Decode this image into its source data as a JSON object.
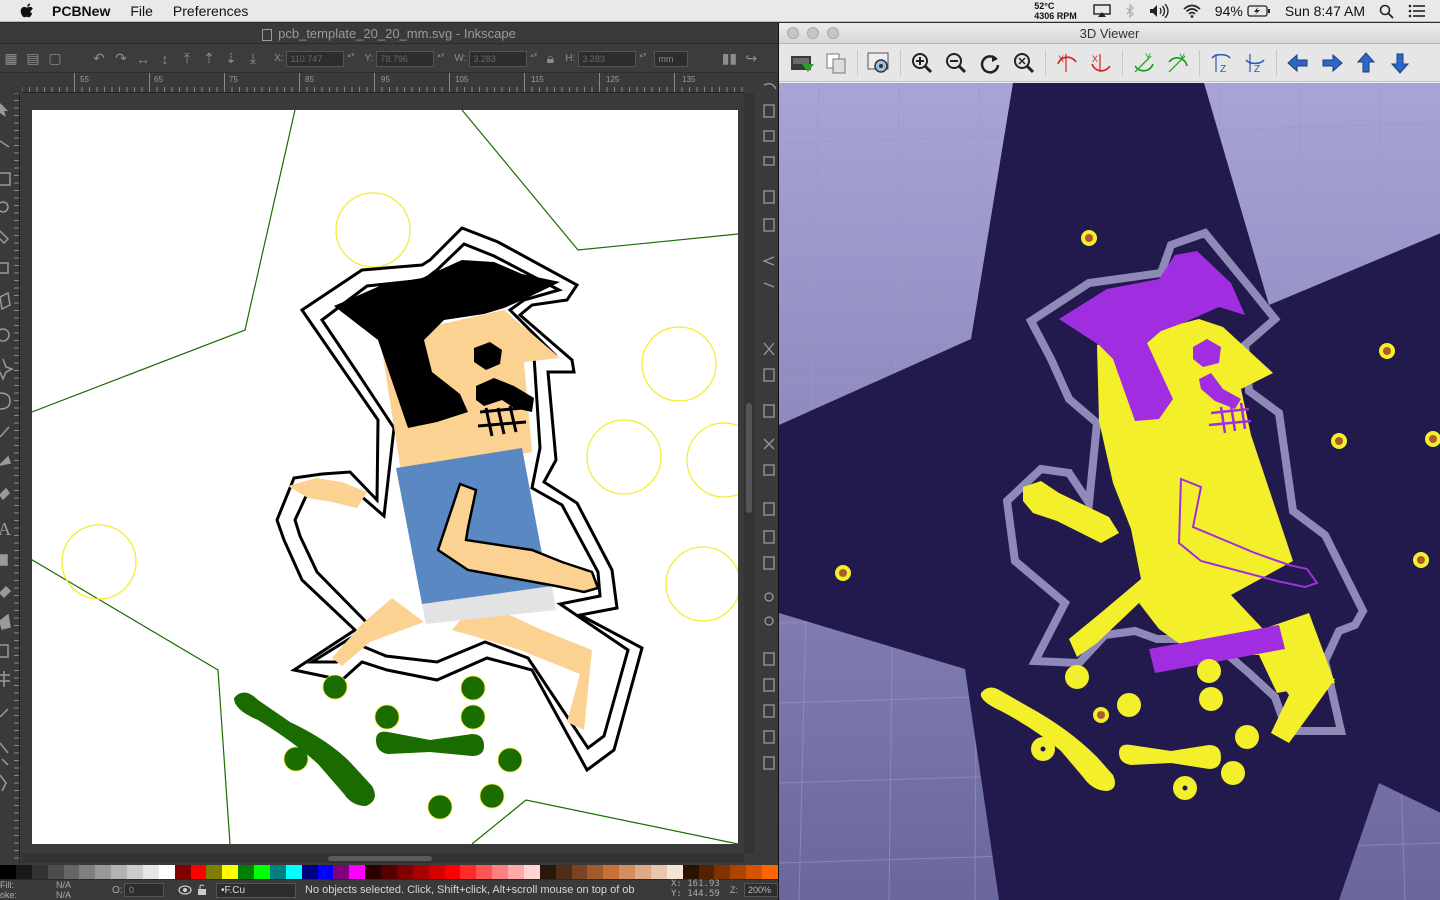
{
  "menubar": {
    "app_name": "PCBNew",
    "menus": [
      "File",
      "Preferences"
    ],
    "temp": "52°C",
    "rpm": "4306 RPM",
    "battery": "94%",
    "clock": "Sun 8:47 AM"
  },
  "inkscape": {
    "title": "pcb_template_20_20_mm.svg - Inkscape",
    "toolbar": {
      "x_label": "X:",
      "x_value": "110.747",
      "y_label": "Y:",
      "y_value": "78.796",
      "w_label": "W:",
      "w_value": "3.283",
      "h_label": "H:",
      "h_value": "3.283",
      "unit": "mm"
    },
    "ruler_ticks": [
      "55",
      "65",
      "75",
      "85",
      "95",
      "105",
      "115",
      "125",
      "135"
    ],
    "status": {
      "fill_label": "Fill:",
      "stroke_label": "oke:",
      "fill_value": "N/A",
      "stroke_value": "N/A",
      "opacity_label": "O:",
      "opacity_value": "0",
      "layer": "•F.Cu",
      "message": "No objects selected. Click, Shift+click, Alt+scroll mouse on top of ob",
      "coord_x_label": "X:",
      "coord_x": "161.93",
      "coord_y_label": "Y:",
      "coord_y": "144.59",
      "zoom_label": "Z:",
      "zoom": "200%"
    },
    "palette_colors": [
      "#000000",
      "#1a1a1a",
      "#333333",
      "#4d4d4d",
      "#666666",
      "#808080",
      "#999999",
      "#b3b3b3",
      "#cccccc",
      "#e6e6e6",
      "#ffffff",
      "#800000",
      "#ff0000",
      "#808000",
      "#ffff00",
      "#008000",
      "#00ff00",
      "#008080",
      "#00ffff",
      "#000080",
      "#0000ff",
      "#800080",
      "#ff00ff",
      "#2b0000",
      "#550000",
      "#800000",
      "#aa0000",
      "#d40000",
      "#ff0000",
      "#ff2a2a",
      "#ff5555",
      "#ff8080",
      "#ffaaaa",
      "#ffd5d5",
      "#28170b",
      "#502d16",
      "#784421",
      "#a05a2c",
      "#c87137",
      "#d38d5f",
      "#deaa87",
      "#e9c6af",
      "#f4e3d7",
      "#2b1100",
      "#552200",
      "#803300",
      "#aa4400",
      "#d45500",
      "#ff6600"
    ]
  },
  "viewer3d": {
    "title": "3D Viewer",
    "toolbar_icons": [
      "reload-icon",
      "copy-icon",
      "settings-icon",
      "zoom-in-icon",
      "zoom-out-icon",
      "redraw-icon",
      "zoom-fit-icon",
      "rotate-x-cw-icon",
      "rotate-x-ccw-icon",
      "rotate-y-cw-icon",
      "rotate-y-ccw-icon",
      "rotate-z-cw-icon",
      "rotate-z-ccw-icon",
      "pan-left-icon",
      "pan-right-icon",
      "pan-up-icon",
      "pan-down-icon"
    ]
  },
  "colors": {
    "board": "#22194c",
    "copper": "#f3ef2a",
    "silk": "#a02ee0",
    "mask_line": "#8f89b8",
    "ink_green": "#1a6b00"
  }
}
